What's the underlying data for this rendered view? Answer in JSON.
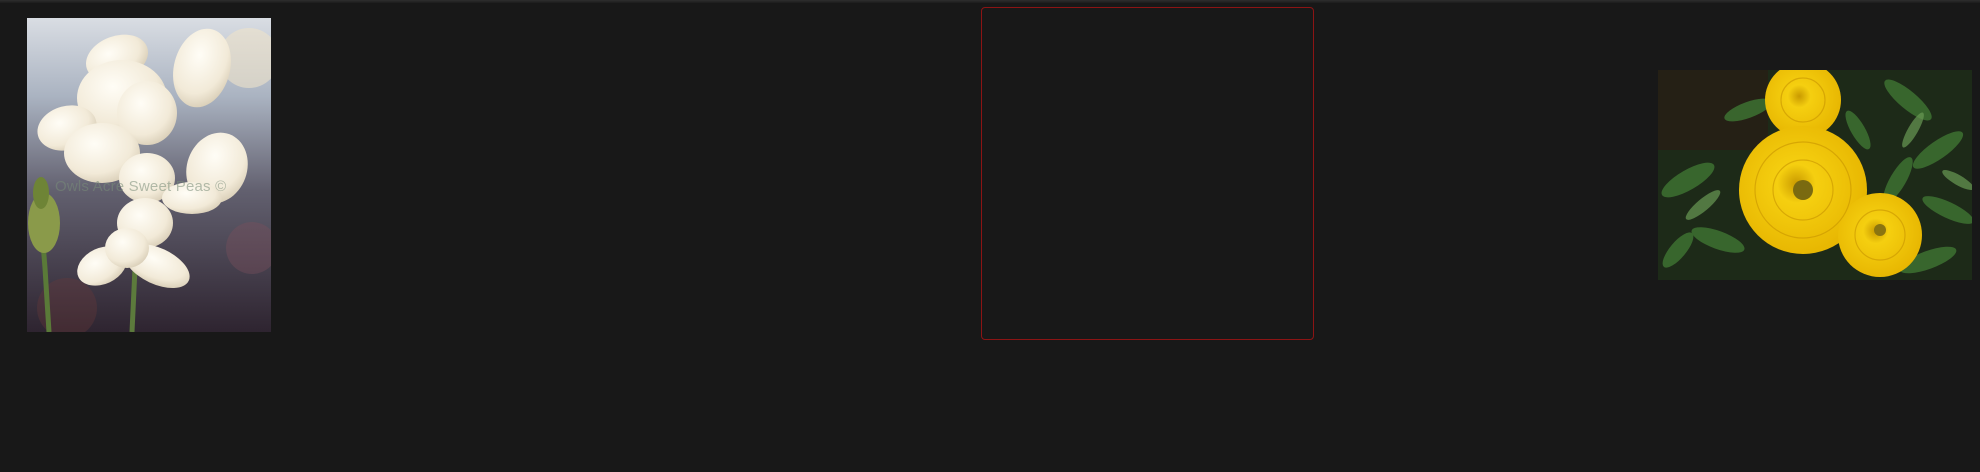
{
  "gallery": {
    "items": [
      {
        "kind": "photo",
        "icon": "sweet-pea-photo",
        "watermark": "Owls Acre Sweet Peas ©"
      },
      {
        "kind": "empty-selection-frame",
        "border_color": "#8b1414"
      },
      {
        "kind": "photo",
        "icon": "marigold-photo"
      }
    ]
  },
  "colors": {
    "background": "#181818",
    "frame_border": "#8b1414",
    "marigold": "#f2c400",
    "foliage": "#2f5a27"
  }
}
